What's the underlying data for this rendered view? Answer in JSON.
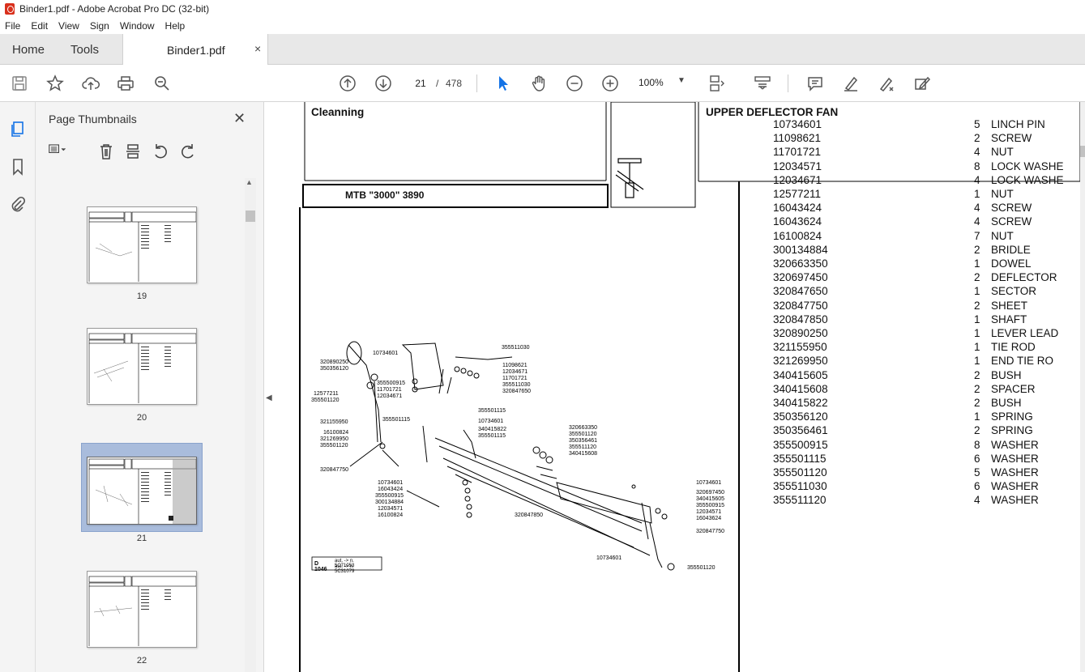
{
  "window": {
    "title": "Binder1.pdf - Adobe Acrobat Pro DC (32-bit)"
  },
  "menu": [
    "File",
    "Edit",
    "View",
    "Sign",
    "Window",
    "Help"
  ],
  "tabs": {
    "home": "Home",
    "tools": "Tools",
    "document": "Binder1.pdf",
    "close": "×"
  },
  "toolbar": {
    "current_page": "21",
    "page_separator": "/",
    "total_pages": "478",
    "zoom": "100%"
  },
  "panel": {
    "title": "Page Thumbnails",
    "close": "✕",
    "thumbnails": [
      {
        "label": "19",
        "selected": false
      },
      {
        "label": "20",
        "selected": false
      },
      {
        "label": "21",
        "selected": true
      },
      {
        "label": "22",
        "selected": false
      }
    ]
  },
  "page": {
    "section": "Cleanning",
    "model": "MTB \"3000\" 3890",
    "group_title": "UPPER DEFLECTOR FAN",
    "diagram_code": "D 1046",
    "diagram_notes": [
      "aut. -> n. 5C71053",
      "aut. -> n. 5C31079"
    ],
    "diagram_labels": {
      "a": "10734601",
      "b": "320890250",
      "c": "350356120",
      "d": "355511030",
      "e": "11098621",
      "f": "12034671",
      "g": "11701721",
      "h": "355511030",
      "i": "320847650",
      "j": "355500915",
      "k": "11701721",
      "l": "12034671",
      "m": "12577211",
      "n": "355501120",
      "o": "321155950",
      "p": "355501115",
      "q": "355501115",
      "r": "10734601",
      "s": "340415822",
      "t": "355501115",
      "u": "16100824",
      "v": "321269950",
      "w": "355501120",
      "x": "320663350",
      "y": "355501120",
      "z": "350356461",
      "aa": "355511120",
      "ab": "340415608",
      "ac": "320847750",
      "ad": "10734601",
      "ae": "16043424",
      "af": "355500915",
      "ag": "300134884",
      "ah": "12034571",
      "ai": "16100824",
      "aj": "320847850",
      "ak": "10734601",
      "al": "320697450",
      "am": "340415605",
      "an": "355500915",
      "ao": "12034571",
      "ap": "16043624",
      "aq": "320847750",
      "ar": "10734601",
      "as": "355501120"
    },
    "parts": [
      {
        "code": "10734601",
        "qty": "5",
        "desc": "LINCH PIN"
      },
      {
        "code": "11098621",
        "qty": "2",
        "desc": "SCREW"
      },
      {
        "code": "11701721",
        "qty": "4",
        "desc": "NUT"
      },
      {
        "code": "12034571",
        "qty": "8",
        "desc": "LOCK WASHE"
      },
      {
        "code": "12034671",
        "qty": "4",
        "desc": "LOCK WASHE"
      },
      {
        "code": "12577211",
        "qty": "1",
        "desc": "NUT"
      },
      {
        "code": "16043424",
        "qty": "4",
        "desc": "SCREW"
      },
      {
        "code": "16043624",
        "qty": "4",
        "desc": "SCREW"
      },
      {
        "code": "16100824",
        "qty": "7",
        "desc": "NUT"
      },
      {
        "code": "300134884",
        "qty": "2",
        "desc": "BRIDLE"
      },
      {
        "code": "320663350",
        "qty": "1",
        "desc": "DOWEL"
      },
      {
        "code": "320697450",
        "qty": "2",
        "desc": "DEFLECTOR"
      },
      {
        "code": "320847650",
        "qty": "1",
        "desc": "SECTOR"
      },
      {
        "code": "320847750",
        "qty": "2",
        "desc": "SHEET"
      },
      {
        "code": "320847850",
        "qty": "1",
        "desc": "SHAFT"
      },
      {
        "code": "320890250",
        "qty": "1",
        "desc": "LEVER LEAD"
      },
      {
        "code": "321155950",
        "qty": "1",
        "desc": "TIE ROD"
      },
      {
        "code": "321269950",
        "qty": "1",
        "desc": "END TIE RO"
      },
      {
        "code": "340415605",
        "qty": "2",
        "desc": "BUSH"
      },
      {
        "code": "340415608",
        "qty": "2",
        "desc": "SPACER"
      },
      {
        "code": "340415822",
        "qty": "2",
        "desc": "BUSH"
      },
      {
        "code": "350356120",
        "qty": "1",
        "desc": "SPRING"
      },
      {
        "code": "350356461",
        "qty": "2",
        "desc": "SPRING"
      },
      {
        "code": "355500915",
        "qty": "8",
        "desc": "WASHER"
      },
      {
        "code": "355501115",
        "qty": "6",
        "desc": "WASHER"
      },
      {
        "code": "355501120",
        "qty": "5",
        "desc": "WASHER"
      },
      {
        "code": "355511030",
        "qty": "6",
        "desc": "WASHER"
      },
      {
        "code": "355511120",
        "qty": "4",
        "desc": "WASHER"
      }
    ]
  },
  "colors": {
    "accent": "#1473e6",
    "pdf_red": "#d9301c",
    "selected_thumb": "#a9bcdc"
  }
}
